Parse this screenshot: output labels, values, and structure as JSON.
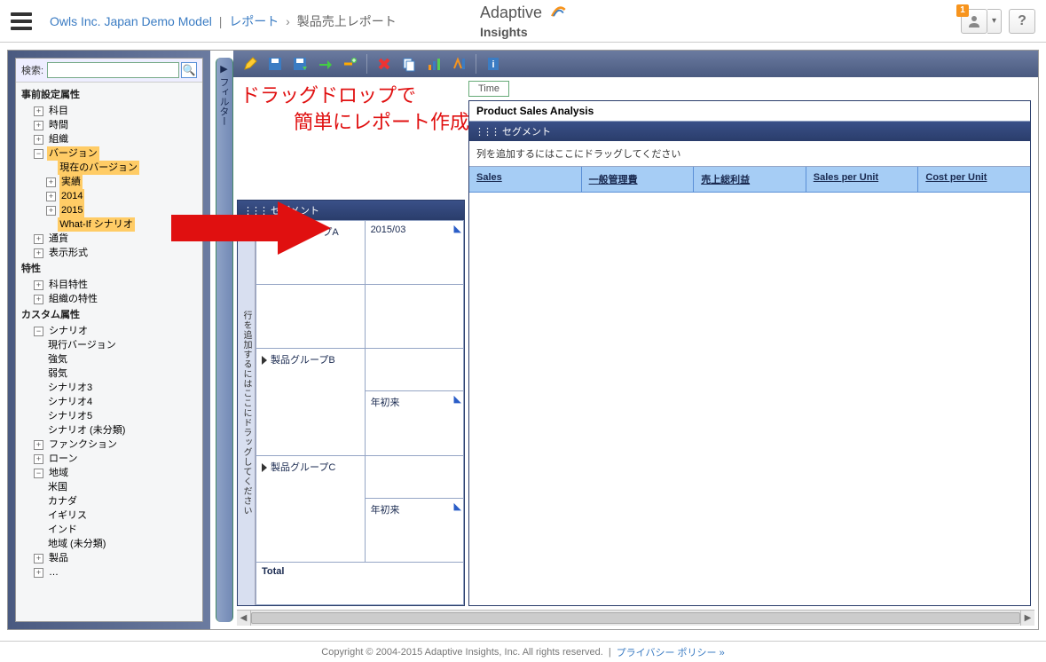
{
  "header": {
    "model": "Owls Inc. Japan Demo Model",
    "crumb1": "レポート",
    "crumb2": "製品売上レポート",
    "logo_a": "Adaptive",
    "logo_b": "Insights",
    "user_badge": "1",
    "help": "?"
  },
  "sidebar": {
    "search_label": "検索:",
    "sections": {
      "preset": "事前設定属性",
      "account": "科目",
      "time": "時間",
      "org": "組織",
      "version": "バージョン",
      "current_version": "現在のバージョン",
      "actual": "実績",
      "y2014": "2014",
      "y2015": "2015",
      "whatif": "What-If シナリオ",
      "currency": "通貨",
      "display": "表示形式",
      "attributes": "特性",
      "acct_attr": "科目特性",
      "org_attr": "組織の特性",
      "custom": "カスタム属性",
      "scenario": "シナリオ",
      "running_version": "現行バージョン",
      "bull": "強気",
      "bear": "弱気",
      "s3": "シナリオ3",
      "s4": "シナリオ4",
      "s5": "シナリオ5",
      "s_uncat": "シナリオ (未分類)",
      "function": "ファンクション",
      "loan": "ローン",
      "region": "地域",
      "us": "米国",
      "canada": "カナダ",
      "uk": "イギリス",
      "india": "インド",
      "region_uncat": "地域 (未分類)",
      "product": "製品",
      "more": "…"
    }
  },
  "filter_tab": "▶ フィルター",
  "annotation": {
    "line1": "ドラッグドロップで",
    "line2": "簡単にレポート作成"
  },
  "segment_panel": {
    "title": "セグメント",
    "vtab": "行を追加するにはここにドラッグしてください",
    "rows": {
      "groupA": "製品グループA",
      "groupA_time": "2015/03",
      "groupB": "製品グループB",
      "groupB_time": "年初来",
      "groupC": "製品グループC",
      "groupC_time": "年初来",
      "total": "Total"
    }
  },
  "right": {
    "time_chip": "Time",
    "report_title": "Product Sales Analysis",
    "segment_bar": "セグメント",
    "drop_hint": "列を追加するにはここにドラッグしてください",
    "cols": {
      "c1": "Sales",
      "c2": "一般管理費",
      "c3": "売上総利益",
      "c4": "Sales per Unit",
      "c5": "Cost per Unit"
    }
  },
  "footer": {
    "copyright": "Copyright © 2004-2015 Adaptive Insights, Inc. All rights reserved.",
    "sep": "|",
    "privacy": "プライバシー ポリシー »"
  }
}
